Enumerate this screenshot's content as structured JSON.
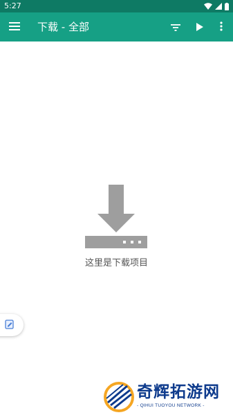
{
  "status_bar": {
    "time": "5:27",
    "icons": [
      "wifi-icon",
      "signal-icon",
      "battery-icon"
    ]
  },
  "app_bar": {
    "title": "下载 - 全部",
    "icons": [
      "menu-icon",
      "filter-icon",
      "play-icon",
      "more-vert-icon"
    ],
    "color": "#16a085"
  },
  "empty_state": {
    "icon": "download-tray-icon",
    "message": "这里是下载项目"
  },
  "floating_tab": {
    "icon": "note-edit-icon"
  },
  "watermark": {
    "title": "奇辉拓游网",
    "subtitle": "- QIHUI TUOYOU NETWORK -"
  },
  "colors": {
    "status_bar": "#0e7a64",
    "app_bar": "#16a085",
    "empty_icon": "#9e9e9e",
    "watermark_blue": "#0d3a8c",
    "watermark_orange": "#f5a623"
  }
}
